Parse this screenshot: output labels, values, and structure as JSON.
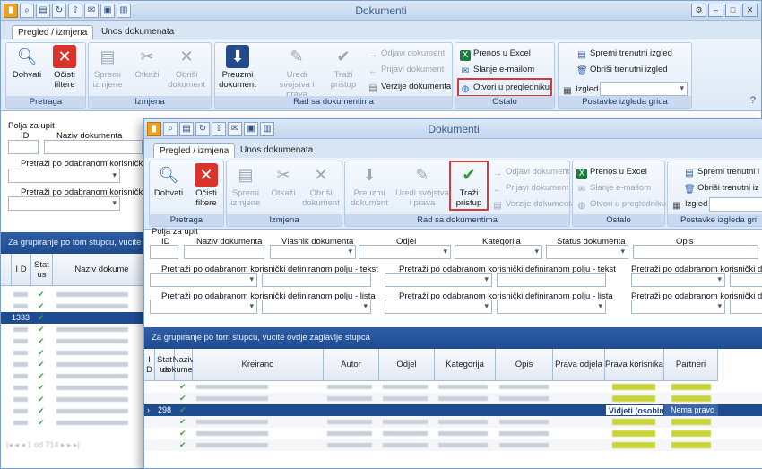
{
  "back": {
    "title": "Dokumenti",
    "tabs": [
      "Pregled / izmjena",
      "Unos dokumenata"
    ],
    "pretraga": {
      "label": "Pretraga",
      "dohvati": "Dohvati",
      "ocisti": "Očisti filtere"
    },
    "izmjena": {
      "label": "Izmjena",
      "spremi": "Spremi izmjene",
      "otkazi": "Otkaži",
      "obrisi": "Obriši dokument"
    },
    "rad": {
      "label": "Rad sa dokumentima",
      "preuzmi": "Preuzmi dokument",
      "uredi": "Uredi svojstva i prava",
      "trazi": "Traži pristup",
      "odjavi": "Odjavi dokument",
      "prijavi": "Prijavi dokument",
      "verzije": "Verzije dokumenta"
    },
    "ostalo": {
      "label": "Ostalo",
      "prenos": "Prenos u Excel",
      "slanje": "Slanje e-mailom",
      "otvori": "Otvori u pregledniku"
    },
    "postavke": {
      "label": "Postavke izgleda grida",
      "spremi": "Spremi trenutni izgled",
      "obrisi": "Obriši trenutni izgled",
      "izgled": "Izgled"
    },
    "filters": {
      "polja": "Polja za upit",
      "id": "ID",
      "naziv": "Naziv dokumenta",
      "tekst": "Pretraži po odabranom korisnički d",
      "lista": "Pretraži po odabranom korisničk"
    },
    "group_hint": "Za grupiranje po tom stupcu, vucite c",
    "cols": {
      "i": "I D",
      "status": "Stat us",
      "naziv": "Naziv dokume"
    },
    "selected_id": "1333"
  },
  "front": {
    "title": "Dokumenti",
    "tabs": [
      "Pregled / izmjena",
      "Unos dokumenata"
    ],
    "pretraga": {
      "label": "Pretraga",
      "dohvati": "Dohvati",
      "ocisti": "Očisti filtere"
    },
    "izmjena": {
      "label": "Izmjena",
      "spremi": "Spremi izmjene",
      "otkazi": "Otkaži",
      "obrisi": "Obriši dokument"
    },
    "rad": {
      "label": "Rad sa dokumentima",
      "preuzmi": "Preuzmi dokument",
      "uredi": "Uredi svojstva i prava",
      "trazi": "Traži pristup",
      "odjavi": "Odjavi dokument",
      "prijavi": "Prijavi dokument",
      "verzije": "Verzije dokumenta"
    },
    "ostalo": {
      "label": "Ostalo",
      "prenos": "Prenos u Excel",
      "slanje": "Slanje e-mailom",
      "otvori": "Otvori u pregledniku"
    },
    "postavke": {
      "label": "Postavke izgleda gri",
      "spremi": "Spremi trenutni i",
      "obrisi": "Obriši trenutni iz",
      "izgled": "Izgled"
    },
    "filters": {
      "polja": "Polja za upit",
      "id": "ID",
      "naziv": "Naziv dokumenta",
      "vlasnik": "Vlasnik dokumenta",
      "odjel": "Odjel",
      "kategorija": "Kategorija",
      "status": "Status dokumenta",
      "opis": "Opis",
      "tekst": "Pretraži po odabranom korisnički definiranom polju - tekst",
      "lista": "Pretraži po odabranom korisnički definiranom polju - lista"
    },
    "group_hint": "Za grupiranje po tom stupcu, vucite ovdje zaglavlje stupca",
    "cols": [
      "I D",
      "Stat us",
      "Naziv dokumenta",
      "Kreirano",
      "Autor",
      "Odjel",
      "Kategorija",
      "Opis",
      "Prava odjela",
      "Prava korisnika",
      "Partneri"
    ],
    "selected": {
      "id": "298",
      "prava_odjela": "Vidjeti (osobine)",
      "prava_korisnika": "Nema pravo"
    }
  },
  "colors": {
    "accent": "#1f4c91",
    "highlight": "#d83a3a"
  }
}
